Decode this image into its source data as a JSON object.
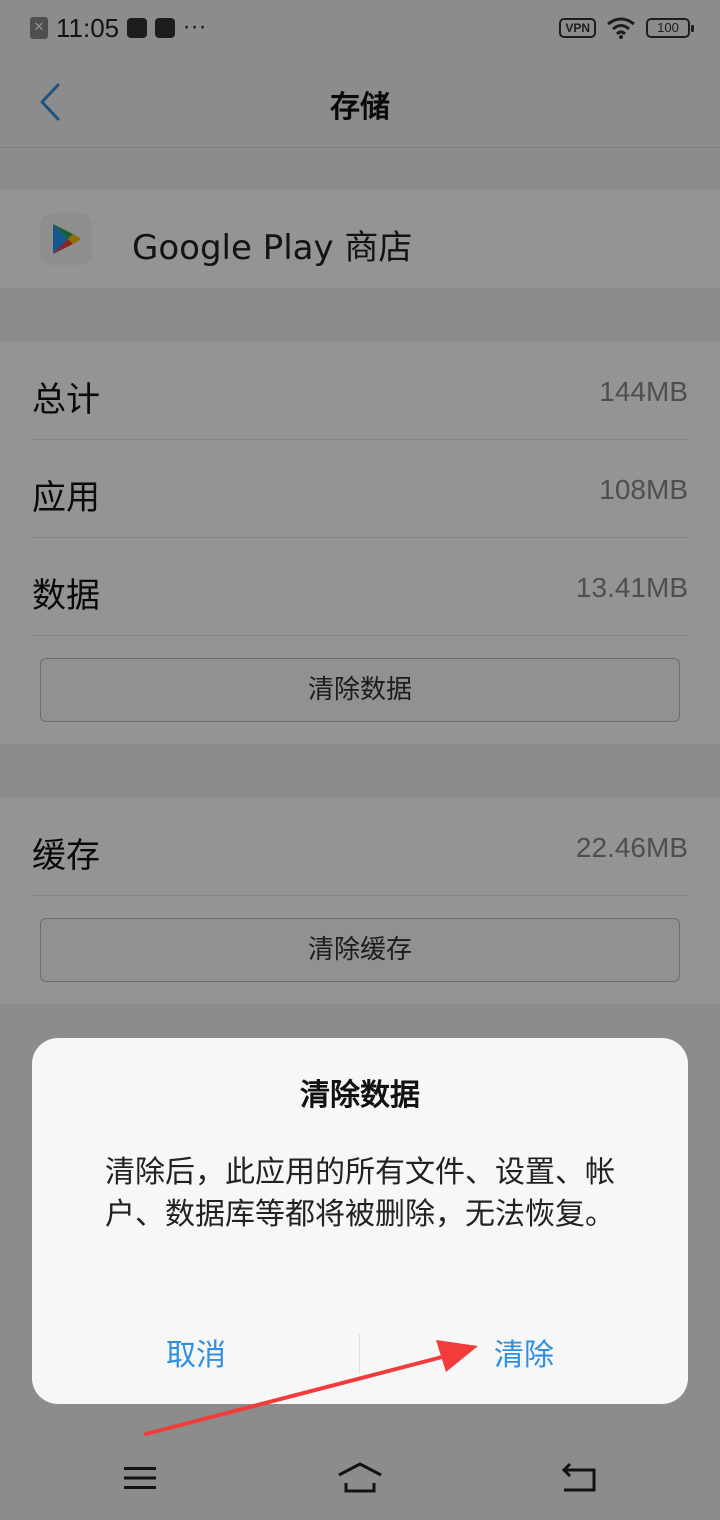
{
  "status_bar": {
    "time": "11:05",
    "dots": "···",
    "vpn_label": "VPN",
    "battery": "100",
    "icons": [
      "notification-x-icon",
      "mail-icon",
      "media-icon",
      "wifi-icon",
      "battery-icon"
    ]
  },
  "header": {
    "title": "存储",
    "back_icon": "back-chevron-icon"
  },
  "app": {
    "name": "Google Play 商店",
    "icon": "google-play-icon"
  },
  "storage": {
    "rows": [
      {
        "label": "总计",
        "value": "144MB"
      },
      {
        "label": "应用",
        "value": "108MB"
      },
      {
        "label": "数据",
        "value": "13.41MB"
      }
    ],
    "clear_data_button": "清除数据"
  },
  "cache": {
    "label": "缓存",
    "value": "22.46MB",
    "clear_cache_button": "清除缓存"
  },
  "dialog": {
    "title": "清除数据",
    "message": "清除后，此应用的所有文件、设置、帐户、数据库等都将被删除，无法恢复。",
    "cancel_label": "取消",
    "confirm_label": "清除"
  },
  "navigation_bar": {
    "icons": [
      "menu-icon",
      "home-icon",
      "back-icon"
    ]
  },
  "colors": {
    "accent": "#2f8fe2",
    "annotation_arrow": "#f23c3c",
    "scrim": "rgba(0,0,0,0.42)"
  }
}
